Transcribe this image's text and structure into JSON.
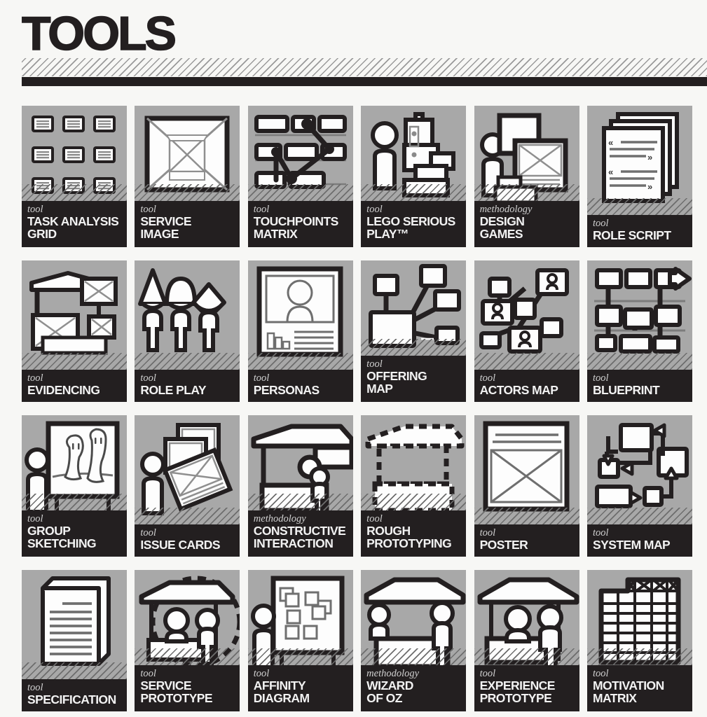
{
  "header": {
    "title": "TOOLS"
  },
  "grid": {
    "columns": 6,
    "rows": 4,
    "cards": [
      {
        "category": "tool",
        "title": "TASK ANALYSIS\nGRID",
        "icon": "grid-of-cards-icon",
        "lines": 2
      },
      {
        "category": "tool",
        "title": "SERVICE\nIMAGE",
        "icon": "framed-image-icon",
        "lines": 2
      },
      {
        "category": "tool",
        "title": "TOUCHPOINTS\nMATRIX",
        "icon": "touchpoint-network-icon",
        "lines": 2
      },
      {
        "category": "tool",
        "title": "LEGO SERIOUS\nPLAY™",
        "icon": "lego-bricks-person-icon",
        "lines": 2
      },
      {
        "category": "methodology",
        "title": "DESIGN\nGAMES",
        "icon": "person-board-icon",
        "lines": 2
      },
      {
        "category": "tool",
        "title": "ROLE SCRIPT",
        "icon": "script-pages-icon",
        "lines": 1
      },
      {
        "category": "tool",
        "title": "EVIDENCING",
        "icon": "evidence-board-icon",
        "lines": 1
      },
      {
        "category": "tool",
        "title": "ROLE PLAY",
        "icon": "three-actors-icon",
        "lines": 1
      },
      {
        "category": "tool",
        "title": "PERSONAS",
        "icon": "persona-card-icon",
        "lines": 1
      },
      {
        "category": "tool",
        "title": "OFFERING\nMAP",
        "icon": "offering-nodes-icon",
        "lines": 2
      },
      {
        "category": "tool",
        "title": "ACTORS MAP",
        "icon": "actors-network-icon",
        "lines": 1
      },
      {
        "category": "tool",
        "title": "BLUEPRINT",
        "icon": "blueprint-flow-icon",
        "lines": 1
      },
      {
        "category": "tool",
        "title": "GROUP\nSKETCHING",
        "icon": "sketching-board-icon",
        "lines": 2
      },
      {
        "category": "tool",
        "title": "ISSUE CARDS",
        "icon": "stacked-cards-icon",
        "lines": 1
      },
      {
        "category": "methodology",
        "title": "CONSTRUCTIVE\nINTERACTION",
        "icon": "two-people-counter-icon",
        "lines": 2
      },
      {
        "category": "tool",
        "title": "ROUGH\nPROTOTYPING",
        "icon": "dashed-counter-icon",
        "lines": 2
      },
      {
        "category": "tool",
        "title": "POSTER",
        "icon": "poster-sheet-icon",
        "lines": 1
      },
      {
        "category": "tool",
        "title": "SYSTEM MAP",
        "icon": "system-arrows-icon",
        "lines": 1
      },
      {
        "category": "tool",
        "title": "SPECIFICATION",
        "icon": "document-sheet-icon",
        "lines": 1
      },
      {
        "category": "tool",
        "title": "SERVICE\nPROTOTYPE",
        "icon": "counter-dashed-circle-icon",
        "lines": 2
      },
      {
        "category": "tool",
        "title": "AFFINITY\nDIAGRAM",
        "icon": "sticky-notes-board-icon",
        "lines": 2
      },
      {
        "category": "methodology",
        "title": "WIZARD\nOF OZ",
        "icon": "counter-screen-icon",
        "lines": 2
      },
      {
        "category": "tool",
        "title": "EXPERIENCE\nPROTOTYPE",
        "icon": "counter-two-people-icon",
        "lines": 2
      },
      {
        "category": "tool",
        "title": "MOTIVATION\nMATRIX",
        "icon": "matrix-grid-icon",
        "lines": 2
      }
    ]
  },
  "colors": {
    "page_background": "#f7f7f5",
    "card_art_background": "#a8a8a8",
    "label_background": "#231f20",
    "ink": "#231f20",
    "paper": "#fdfdfd",
    "category_text": "#d0d0d0",
    "title_text": "#f2f2f2"
  }
}
